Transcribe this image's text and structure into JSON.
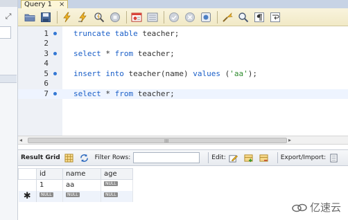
{
  "tab": {
    "title": "Query 1",
    "close": "×"
  },
  "left": {
    "expand_icon": "⤢"
  },
  "toolbar": {
    "icons": [
      "open-folder-icon",
      "save-icon",
      "execute-icon",
      "execute-current-icon",
      "explain-icon",
      "stop-icon",
      "toggle-results-icon",
      "toggle-output-icon",
      "commit-icon",
      "rollback-icon",
      "autocommit-icon",
      "beautify-icon",
      "find-icon",
      "invisible-chars-icon",
      "wrap-icon"
    ]
  },
  "editor": {
    "lines": [
      {
        "n": "1",
        "dot": true
      },
      {
        "n": "2",
        "dot": false
      },
      {
        "n": "3",
        "dot": true
      },
      {
        "n": "4",
        "dot": false
      },
      {
        "n": "5",
        "dot": true
      },
      {
        "n": "6",
        "dot": false
      },
      {
        "n": "7",
        "dot": true
      }
    ],
    "code": {
      "l1_kw": "truncate table",
      "l1_rest": " teacher;",
      "l3_kw1": "select",
      "l3_mid": " * ",
      "l3_kw2": "from",
      "l3_rest": " teacher;",
      "l5_kw1": "insert into",
      "l5_mid": " teacher(name) ",
      "l5_kw2": "values",
      "l5_p1": " (",
      "l5_str": "'aa'",
      "l5_p2": ");",
      "l7_kw1": "select",
      "l7_mid": " * ",
      "l7_kw2": "from",
      "l7_rest": " teacher;"
    }
  },
  "scroll": {
    "left_arrow": "◂",
    "grip": "III",
    "right_arrow": "▸"
  },
  "result_toolbar": {
    "result_grid": "Result Grid",
    "filter_rows": "Filter Rows:",
    "edit": "Edit:",
    "export_import": "Export/Import:"
  },
  "grid": {
    "columns": [
      "id",
      "name",
      "age"
    ],
    "rows": [
      {
        "id": "1",
        "name": "aa",
        "age_null": "NULL"
      }
    ],
    "new_row": {
      "marker": "✱",
      "id": "NULL",
      "name": "NULL",
      "age": "NULL"
    }
  },
  "watermark": {
    "text": "亿速云"
  }
}
